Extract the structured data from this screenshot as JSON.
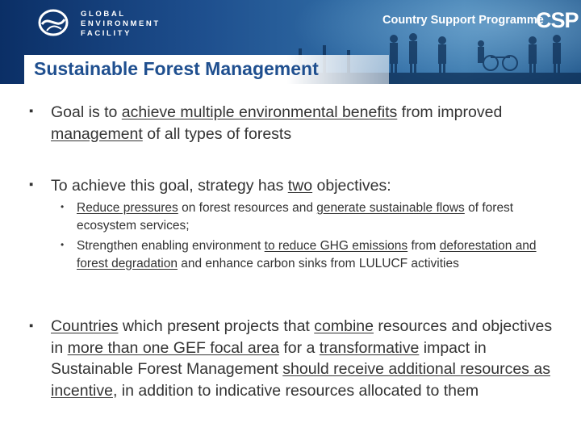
{
  "header": {
    "org_lines": [
      "GLOBAL",
      "ENVIRONMENT",
      "FACILITY"
    ],
    "programme": "Country Support Programme",
    "programme_logo": "CSP",
    "logo_icon": "gef-globe-icon",
    "brand_color": "#1f4f8f",
    "banner_color": "#1e4f8e"
  },
  "slide": {
    "title": "Sustainable Forest Management",
    "bullet1": {
      "t1": "Goal is to ",
      "u1": "achieve multiple environmental benefits",
      "t2": " from improved ",
      "u2": "management",
      "t3": " of all types of forests"
    },
    "bullet2": {
      "t1": "To achieve this goal, strategy has ",
      "u1": "two",
      "t2": " objectives:",
      "sub1": {
        "u1": "Reduce pressures",
        "t1": " on forest resources and ",
        "u2": "generate sustainable flows",
        "t2": " of forest ecosystem services;"
      },
      "sub2": {
        "t1": "Strengthen enabling environment ",
        "u1": "to reduce GHG emissions",
        "t2": " from ",
        "u2": "deforestation and forest degradation",
        "t3": " and enhance carbon sinks from LULUCF activities"
      }
    },
    "bullet3": {
      "u1": "Countries",
      "t1": " which present projects that ",
      "u2": "combine",
      "t2": " resources and objectives in ",
      "u3": "more than one GEF focal area",
      "t3": " for a ",
      "u4": "transformative",
      "t4": " impact in Sustainable Forest Management ",
      "u5": "should receive additional resources as incentive",
      "t5": ", in addition to indicative resources allocated to them"
    }
  }
}
